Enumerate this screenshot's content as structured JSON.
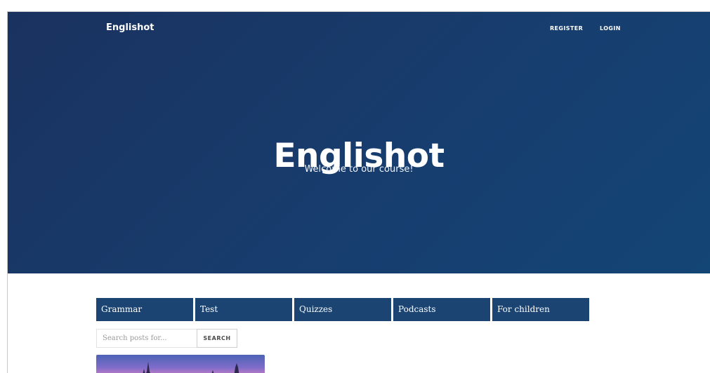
{
  "header": {
    "brand": "Englishot",
    "nav": [
      {
        "label": "REGISTER"
      },
      {
        "label": "LOGIN"
      }
    ]
  },
  "hero": {
    "title": "Englishot",
    "subtitle": "Welcome to our course!",
    "colors": {
      "gradient_start": "#1a325f",
      "gradient_end": "#134575"
    }
  },
  "categories": [
    {
      "label": "Grammar"
    },
    {
      "label": "Test"
    },
    {
      "label": "Quizzes"
    },
    {
      "label": "Podcasts"
    },
    {
      "label": "For children"
    }
  ],
  "category_color": "#1b4472",
  "search": {
    "placeholder": "Search posts for...",
    "value": "",
    "button_label": "SEARCH"
  },
  "post": {
    "thumbnail": "city-skyline-sunset-image"
  }
}
